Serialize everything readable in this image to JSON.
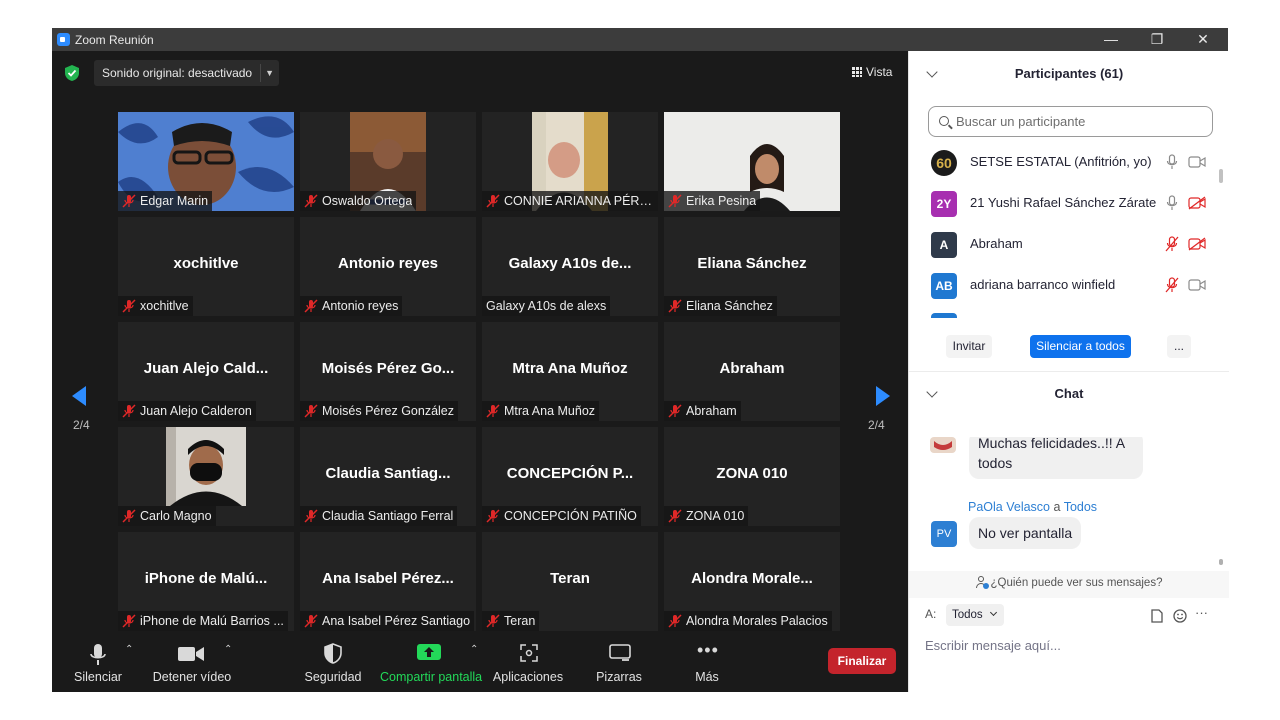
{
  "window": {
    "title": "Zoom Reunión",
    "controls": {
      "minimize": "—",
      "restore": "❐",
      "close": "✕"
    }
  },
  "meeting": {
    "sound_label": "Sonido original: desactivado",
    "view_label": "Vista",
    "page_left": "2/4",
    "page_right": "2/4",
    "tiles": [
      {
        "big": "",
        "name": "Edgar Marin",
        "muted": true,
        "video": true
      },
      {
        "big": "",
        "name": "Oswaldo Ortega",
        "muted": true,
        "video": true
      },
      {
        "big": "",
        "name": "CONNIE ARIANNA PÉRE...",
        "muted": true,
        "video": true
      },
      {
        "big": "",
        "name": "Erika Pesina",
        "muted": true,
        "video": true
      },
      {
        "big": "xochitlve",
        "name": "xochitlve",
        "muted": true,
        "video": false
      },
      {
        "big": "Antonio reyes",
        "name": "Antonio reyes",
        "muted": true,
        "video": false
      },
      {
        "big": "Galaxy A10s de...",
        "name": "Galaxy A10s de alexs",
        "muted": false,
        "video": false
      },
      {
        "big": "Eliana Sánchez",
        "name": "Eliana Sánchez",
        "muted": true,
        "video": false
      },
      {
        "big": "Juan Alejo Cald...",
        "name": "Juan Alejo Calderon",
        "muted": true,
        "video": false
      },
      {
        "big": "Moisés Pérez Go...",
        "name": "Moisés Pérez González",
        "muted": true,
        "video": false
      },
      {
        "big": "Mtra Ana Muñoz",
        "name": "Mtra Ana Muñoz",
        "muted": true,
        "video": false
      },
      {
        "big": "Abraham",
        "name": "Abraham",
        "muted": true,
        "video": false
      },
      {
        "big": "",
        "name": "Carlo Magno",
        "muted": true,
        "video": true
      },
      {
        "big": "Claudia Santiag...",
        "name": "Claudia Santiago Ferral",
        "muted": true,
        "video": false
      },
      {
        "big": "CONCEPCIÓN P...",
        "name": "CONCEPCIÓN PATIÑO",
        "muted": true,
        "video": false
      },
      {
        "big": "ZONA 010",
        "name": "ZONA 010",
        "muted": true,
        "video": false
      },
      {
        "big": "iPhone de Malú...",
        "name": "iPhone de Malú Barrios ...",
        "muted": true,
        "video": false
      },
      {
        "big": "Ana Isabel Pérez...",
        "name": "Ana Isabel Pérez Santiago",
        "muted": true,
        "video": false
      },
      {
        "big": "Teran",
        "name": "Teran",
        "muted": true,
        "video": false
      },
      {
        "big": "Alondra Morale...",
        "name": "Alondra Morales Palacios",
        "muted": true,
        "video": false
      }
    ]
  },
  "toolbar": {
    "mute": "Silenciar",
    "video": "Detener vídeo",
    "security": "Seguridad",
    "share": "Compartir pantalla",
    "apps": "Aplicaciones",
    "whiteboards": "Pizarras",
    "more": "Más",
    "end": "Finalizar"
  },
  "participants": {
    "title": "Participantes (61)",
    "search_placeholder": "Buscar un participante",
    "list": [
      {
        "avatar": "60",
        "name": "SETSE ESTATAL (Anfitrión, yo)",
        "color": "#1b1b1b",
        "mic_muted": false,
        "cam_off": false
      },
      {
        "avatar": "2Y",
        "name": "21 Yushi Rafael Sánchez Zárate",
        "color": "#a72fb0",
        "mic_muted": false,
        "cam_off": true
      },
      {
        "avatar": "A",
        "name": "Abraham",
        "color": "#2f3a4a",
        "mic_muted": true,
        "cam_off": true
      },
      {
        "avatar": "AB",
        "name": "adriana barranco winfield",
        "color": "#1f78d1",
        "mic_muted": true,
        "cam_off": false
      }
    ],
    "invite": "Invitar",
    "mute_all": "Silenciar a todos",
    "more": "..."
  },
  "chat": {
    "title": "Chat",
    "messages": [
      {
        "text_line1": "Muchas felicidades..!! A",
        "text_line2": "todos"
      },
      {
        "sender": "PaOla Velasco",
        "connector": "a",
        "recipient": "Todos",
        "avatar": "PV",
        "text": "No ver pantalla"
      }
    ],
    "who_can_see": "¿Quién puede ver sus mensajes?",
    "to_label": "A:",
    "to_value": "Todos",
    "input_placeholder": "Escribir mensaje aquí...",
    "more": "···"
  },
  "colors": {
    "accent": "#0e72ed",
    "end": "#c4242c",
    "mute_red": "#e02828",
    "share_green": "#23d959"
  }
}
